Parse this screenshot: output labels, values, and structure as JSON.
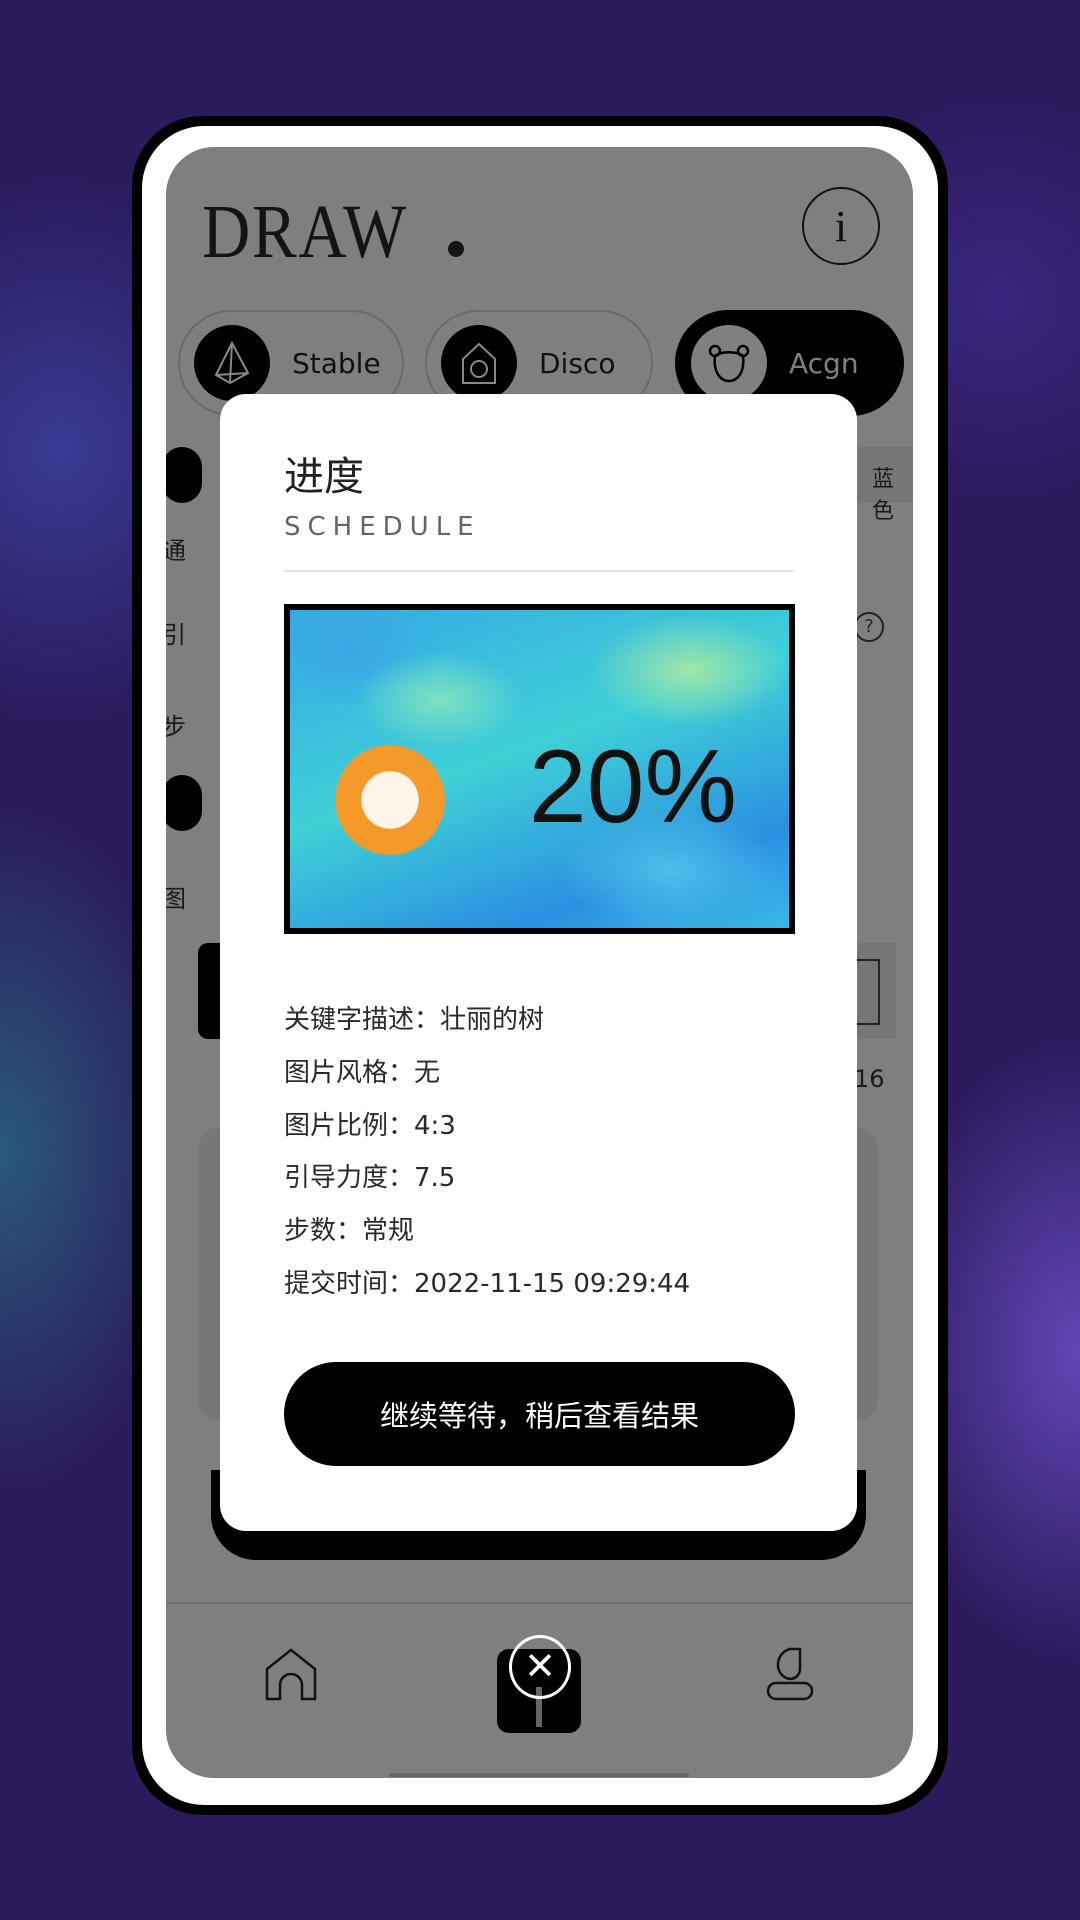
{
  "app": {
    "logo": "DRAW",
    "info_icon": "info-icon"
  },
  "models": [
    {
      "label": "Stable",
      "icon": "pyramid-icon",
      "active": false
    },
    {
      "label": "Disco",
      "icon": "house-circle-icon",
      "active": false
    },
    {
      "label": "Acgn",
      "icon": "bear-icon",
      "active": true
    }
  ],
  "background_fragments": {
    "left": [
      "通",
      "引",
      "步",
      "图"
    ],
    "right_tag": "蓝色",
    "right_number": "16"
  },
  "modal": {
    "title": "进度",
    "subtitle": "SCHEDULE",
    "progress_percent": 20,
    "progress_label": "20%",
    "details": [
      "关键字描述：壮丽的树",
      "图片风格：无",
      "图片比例：4:3",
      "引导力度：7.5",
      "步数：常规",
      "提交时间：2022-11-15 09:29:44"
    ],
    "button": "继续等待，稍后查看结果"
  },
  "nav": {
    "items": [
      "home-icon",
      "close-icon",
      "profile-icon"
    ]
  },
  "colors": {
    "overlay": "#7f7f7f",
    "accent": "#000000",
    "page_bg": "#2b1a5c"
  }
}
